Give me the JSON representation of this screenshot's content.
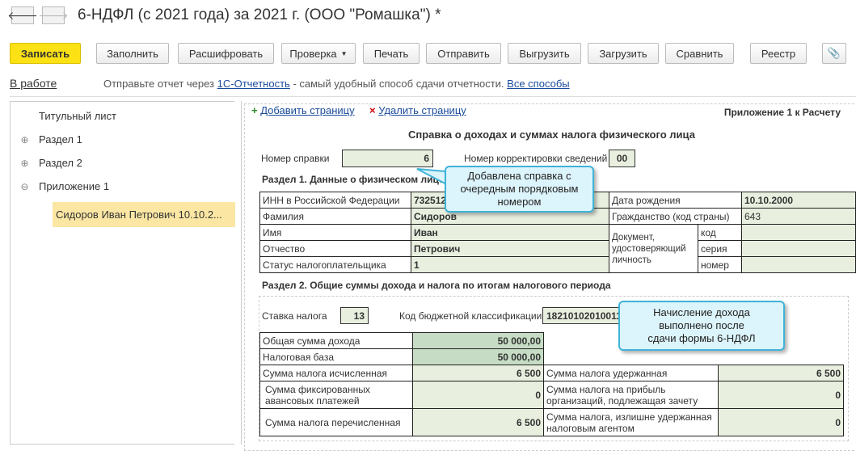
{
  "window": {
    "title": "6-НДФЛ (с 2021 года) за 2021 г. (ООО \"Ромашка\") *"
  },
  "toolbar": [
    "Записать",
    "Заполнить",
    "Расшифровать",
    "Проверка",
    "Печать",
    "Отправить",
    "Выгрузить",
    "Загрузить",
    "Сравнить",
    "Реестр"
  ],
  "status": {
    "state": "В работе",
    "text1": "Отправьте отчет через ",
    "link1": "1С-Отчетность",
    "text2": " - самый удобный способ сдачи отчетности. ",
    "link2": "Все способы"
  },
  "tree": [
    {
      "label": "Титульный лист",
      "expander": ""
    },
    {
      "label": "Раздел 1",
      "expander": "⊕"
    },
    {
      "label": "Раздел 2",
      "expander": "⊕"
    },
    {
      "label": "Приложение 1",
      "expander": "⊖"
    },
    {
      "label": "Сидоров Иван Петрович 10.10.2...",
      "expander": ""
    }
  ],
  "content": {
    "add_page": "Добавить страницу",
    "delete_page": "Удалить страницу",
    "appendix": "Приложение 1 к Расчету",
    "heading": "Справка о доходах и суммах налога физического лица",
    "cert_label": "Номер справки",
    "cert_value": "6",
    "corr_label": "Номер корректировки сведений",
    "corr_value": "00",
    "section1": "Раздел 1. Данные о физическом лице",
    "inn_label": "ИНН в Российской Федерации",
    "inn_value": "732512",
    "surname_label": "Фамилия",
    "surname": "Сидоров",
    "name_label": "Имя",
    "name": "Иван",
    "patronymic_label": "Отчество",
    "patronymic": "Петрович",
    "status_label": "Статус налогоплательщика",
    "status_value": "1",
    "birth_label": "Дата рождения",
    "birth": "10.10.2000",
    "citizen_label": "Гражданство (код страны)",
    "citizen": "643",
    "doc_label": "Документ, удостоверяющий личность",
    "doc_code": "код",
    "doc_series": "серия",
    "doc_number": "номер",
    "section2": "Раздел 2. Общие суммы дохода и налога по итогам налогового периода",
    "rate_label": "Ставка налога",
    "rate": "13",
    "kbk_label": "Код бюджетной классификации",
    "kbk": "182101020100110",
    "income_label": "Общая сумма дохода",
    "income": "50 000,00",
    "base_label": "Налоговая база",
    "base": "50 000,00",
    "calc_label": "Сумма налога исчисленная",
    "calc": "6 500",
    "withheld_label": "Сумма налога удержанная",
    "withheld": "6 500",
    "fixed_label": "Сумма фиксированных авансовых платежей",
    "fixed": "0",
    "profit_label": "Сумма налога на прибыль организаций, подлежащая зачету",
    "profit": "0",
    "paid_label": "Сумма налога перечисленная",
    "paid": "6 500",
    "excess_label": "Сумма налога, излишне удержанная налоговым агентом",
    "excess": "0"
  },
  "callouts": {
    "c1": "Добавлена справка с очередным порядковым номером",
    "c2": "Начисление дохода выполнено после сдачи формы 6-НДФЛ"
  }
}
